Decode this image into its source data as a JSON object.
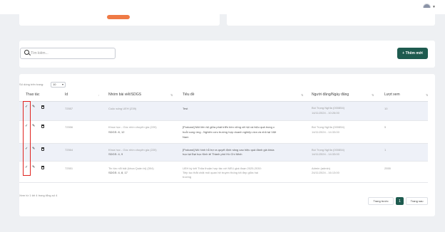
{
  "search": {
    "placeholder": "Tìm kiếm..."
  },
  "toolbar": {
    "add_label": "+ Thêm mới"
  },
  "table": {
    "pagesize_label": "Số dòng trên trang:",
    "pagesize_value": "10",
    "headers": [
      "Thao tác",
      "Id",
      "Nhóm bài viết/SDGS",
      "Tiêu đề",
      "Người đăng/Ngày đăng",
      "Lượt xem"
    ],
    "rows": [
      {
        "id": "72557",
        "group_line1": "Cuộc sống UEH (239)",
        "group_line2": "",
        "title_line1": "Test",
        "title_line2": "",
        "title_line3": "",
        "author": "Bùi Trọng Nghĩa (000854)",
        "date": "14/11/2024 - 10:26:00",
        "views": "10"
      },
      {
        "id": "72556",
        "group_line1": "Khoa học - Góc nhìn chuyên gia (220)",
        "group_line2": "SDGS: 8, 12",
        "title_line1": "[Podcast] Mối liên hệ giữa phát triển bền vững xã hội và hiệu quả trong c",
        "title_line2": "huỗi cung ứng - Nghiên cứu trường hợp doanh nghiệp vừa và nhỏ tại Việt",
        "title_line3": "Nam",
        "author": "Bùi Trọng Nghĩa (000854)",
        "date": "14/11/2024 - 14:33:00",
        "views": "5"
      },
      {
        "id": "72564",
        "group_line1": "Khoa học - Góc nhìn chuyên gia (220)",
        "group_line2": "SDGS: 4, 9",
        "title_line1": "[Podcast] Mô hình hỗ trợ ra quyết định nâng cao hiệu quả đánh giá khóa",
        "title_line2": "học tại Đại học Kinh tế Thành phố Hồ Chí Minh",
        "title_line3": "",
        "author": "Bùi Trọng Nghĩa (000854)",
        "date": "14/11/2024 - 14:33:00",
        "views": "1"
      },
      {
        "id": "72551",
        "group_line1": "Tin tức nổi bật (khoa Quản trị) (304)",
        "group_line2": "SDGS: 4, 8, 17",
        "title_line1": "UEH ký kết Thỏa thuận hợp tác với NEU giai đoạn 2025-2030:",
        "title_line2": "Tiếp tục thắt chặt mối quan hệ truyền thống tốt đẹp giữa hai",
        "title_line3": "trường",
        "author": "Admin (admin)",
        "date": "24/11/2024 - 16:13:00",
        "views": "2555"
      }
    ],
    "footer": "Xem từ 1 tới 4 trong tổng số 4",
    "prev_label": "Trang trước",
    "page_number": "1",
    "next_label": "Trang sau"
  },
  "icons": {
    "approve": "check-icon",
    "edit": "pencil-icon",
    "delete": "trash-icon",
    "search": "search-icon"
  },
  "colors": {
    "accent": "#1e5b4f",
    "highlight": "#e0231f",
    "orange": "#ef7a45"
  }
}
